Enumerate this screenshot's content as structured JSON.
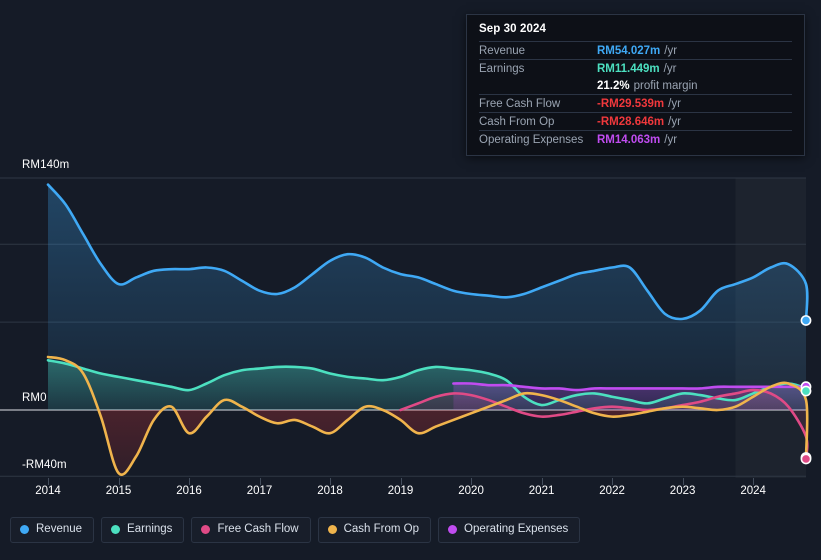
{
  "tooltip": {
    "date": "Sep 30 2024",
    "rows": [
      {
        "label": "Revenue",
        "value": "RM54.027m",
        "unit": "/yr",
        "color": "#3fa9f5"
      },
      {
        "label": "Earnings",
        "value": "RM11.449m",
        "unit": "/yr",
        "color": "#4ce0c0"
      },
      {
        "label": "",
        "value": "21.2%",
        "unit": "profit margin",
        "color": "#ffffff"
      },
      {
        "label": "Free Cash Flow",
        "value": "-RM29.539m",
        "unit": "/yr",
        "color": "#f0383c"
      },
      {
        "label": "Cash From Op",
        "value": "-RM28.646m",
        "unit": "/yr",
        "color": "#f0383c"
      },
      {
        "label": "Operating Expenses",
        "value": "RM14.063m",
        "unit": "/yr",
        "color": "#c04cf0"
      }
    ]
  },
  "axis": {
    "y_top_label": "RM140m",
    "y_zero_label": "RM0",
    "y_bottom_label": "-RM40m",
    "x_labels": [
      "2014",
      "2015",
      "2016",
      "2017",
      "2018",
      "2019",
      "2020",
      "2021",
      "2022",
      "2023",
      "2024"
    ]
  },
  "legend": {
    "items": [
      {
        "label": "Revenue",
        "color": "#3fa9f5"
      },
      {
        "label": "Earnings",
        "color": "#4ce0c0"
      },
      {
        "label": "Free Cash Flow",
        "color": "#e04a86"
      },
      {
        "label": "Cash From Op",
        "color": "#f0b44c"
      },
      {
        "label": "Operating Expenses",
        "color": "#c04cf0"
      }
    ]
  },
  "chart_data": {
    "type": "area",
    "title": "",
    "xlabel": "",
    "ylabel": "RM (millions)",
    "ylim": [
      -40,
      140
    ],
    "xlim": [
      2014,
      2024.75
    ],
    "grid": true,
    "gridlines_y": [
      140,
      100,
      53,
      0,
      -40
    ],
    "zero_line": 0,
    "currency": "RM",
    "units": "millions per year",
    "legend_position": "bottom-left",
    "highlight_band": {
      "from": 2023.75,
      "to": 2024.75,
      "note": "forecast/recent period shading"
    },
    "endpoint_markers": [
      {
        "series": "Revenue",
        "x": 2024.75,
        "y": 54.027
      },
      {
        "series": "Operating Expenses",
        "x": 2024.75,
        "y": 14.063
      },
      {
        "series": "Earnings",
        "x": 2024.75,
        "y": 11.449
      },
      {
        "series": "Cash From Op",
        "x": 2024.75,
        "y": -28.646
      },
      {
        "series": "Free Cash Flow",
        "x": 2024.75,
        "y": -29.539
      }
    ],
    "x": [
      2014.0,
      2014.25,
      2014.5,
      2014.75,
      2015.0,
      2015.25,
      2015.5,
      2015.75,
      2016.0,
      2016.25,
      2016.5,
      2016.75,
      2017.0,
      2017.25,
      2017.5,
      2017.75,
      2018.0,
      2018.25,
      2018.5,
      2018.75,
      2019.0,
      2019.25,
      2019.5,
      2019.75,
      2020.0,
      2020.25,
      2020.5,
      2020.75,
      2021.0,
      2021.25,
      2021.5,
      2021.75,
      2022.0,
      2022.25,
      2022.5,
      2022.75,
      2023.0,
      2023.25,
      2023.5,
      2023.75,
      2024.0,
      2024.25,
      2024.5,
      2024.75
    ],
    "series": [
      {
        "name": "Revenue",
        "color": "#3fa9f5",
        "fill": true,
        "values": [
          136,
          124,
          106,
          88,
          76,
          80,
          84,
          85,
          85,
          86,
          84,
          78,
          72,
          70,
          74,
          82,
          90,
          94,
          92,
          86,
          82,
          80,
          76,
          72,
          70,
          69,
          68,
          70,
          74,
          78,
          82,
          84,
          86,
          86,
          72,
          58,
          55,
          60,
          72,
          76,
          80,
          86,
          88,
          76,
          54.027
        ]
      },
      {
        "name": "Earnings",
        "color": "#4ce0c0",
        "fill": true,
        "values": [
          30,
          28,
          25,
          22,
          20,
          18,
          16,
          14,
          12,
          16,
          21,
          24,
          25,
          26,
          26,
          25,
          22,
          20,
          19,
          18,
          20,
          24,
          26,
          25,
          24,
          22,
          18,
          8,
          3,
          6,
          9,
          10,
          8,
          6,
          4,
          7,
          10,
          9,
          7,
          6,
          10,
          14,
          16,
          13,
          11.449
        ]
      },
      {
        "name": "Free Cash Flow",
        "color": "#e04a86",
        "fill": true,
        "start_x": 2019.0,
        "values": [
          null,
          null,
          null,
          null,
          null,
          null,
          null,
          null,
          null,
          null,
          null,
          null,
          null,
          null,
          null,
          null,
          null,
          null,
          null,
          null,
          0,
          4,
          8,
          10,
          9,
          6,
          2,
          -2,
          -4,
          -3,
          -1,
          1,
          2,
          1,
          0,
          1,
          3,
          5,
          8,
          10,
          12,
          10,
          2,
          -16,
          -29.539
        ]
      },
      {
        "name": "Cash From Op",
        "color": "#f0b44c",
        "fill": true,
        "values": [
          32,
          30,
          22,
          -4,
          -38,
          -28,
          -6,
          2,
          -14,
          -4,
          6,
          2,
          -4,
          -8,
          -6,
          -10,
          -14,
          -6,
          2,
          0,
          -6,
          -14,
          -10,
          -6,
          -2,
          2,
          6,
          10,
          9,
          6,
          2,
          -2,
          -4,
          -3,
          -1,
          1,
          2,
          1,
          0,
          2,
          8,
          14,
          16,
          6,
          -28.646
        ]
      },
      {
        "name": "Operating Expenses",
        "color": "#c04cf0",
        "fill": true,
        "start_x": 2019.75,
        "values": [
          null,
          null,
          null,
          null,
          null,
          null,
          null,
          null,
          null,
          null,
          null,
          null,
          null,
          null,
          null,
          null,
          null,
          null,
          null,
          null,
          null,
          null,
          null,
          16,
          16,
          15,
          15,
          14,
          13,
          13,
          12,
          13,
          13,
          13,
          13,
          13,
          13,
          13,
          14,
          14,
          14,
          14,
          14,
          14,
          14.063
        ]
      }
    ]
  }
}
